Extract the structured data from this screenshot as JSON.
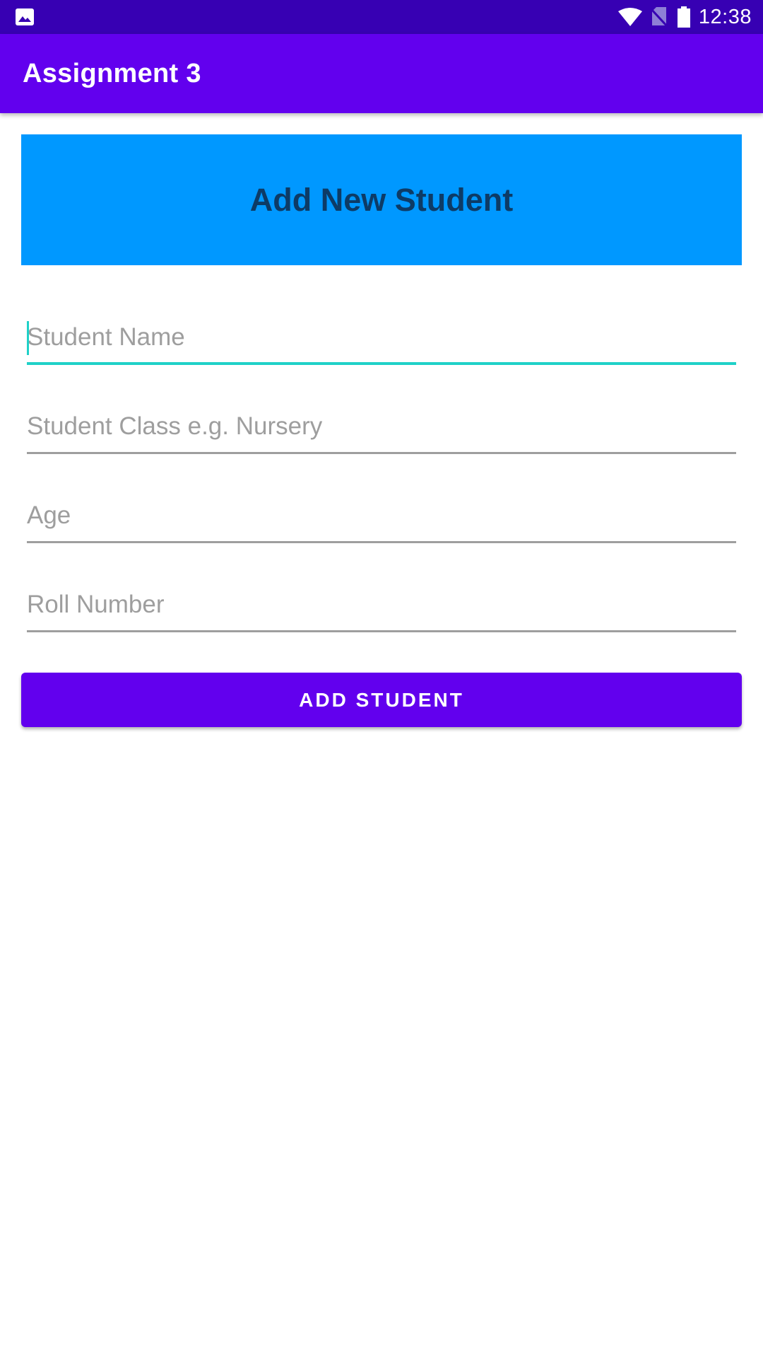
{
  "status_bar": {
    "time": "12:38",
    "icons": [
      "image-icon",
      "wifi-icon",
      "no-sim-icon",
      "battery-icon"
    ]
  },
  "app_bar": {
    "title": "Assignment 3"
  },
  "header": {
    "title": "Add New Student"
  },
  "form": {
    "student_name": {
      "value": "",
      "placeholder": "Student Name",
      "focused": true
    },
    "student_class": {
      "value": "",
      "placeholder": "Student Class e.g. Nursery"
    },
    "age": {
      "value": "",
      "placeholder": "Age"
    },
    "roll_number": {
      "value": "",
      "placeholder": "Roll Number"
    },
    "submit_label": "ADD STUDENT"
  },
  "colors": {
    "status_bar": "#3700b3",
    "primary": "#6200ee",
    "header_banner": "#0098ff",
    "header_text": "#0d3b66",
    "accent": "#1fd1c8"
  }
}
